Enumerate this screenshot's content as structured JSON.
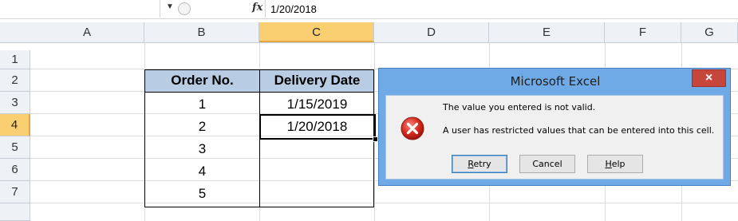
{
  "formula_bar": {
    "fx_label": "fx",
    "value": "1/20/2018"
  },
  "columns": [
    "A",
    "B",
    "C",
    "D",
    "E",
    "F",
    "G"
  ],
  "rows": [
    "1",
    "2",
    "3",
    "4",
    "5",
    "6",
    "7"
  ],
  "selected_column": "C",
  "selected_row": "4",
  "table": {
    "headers": [
      "Order No.",
      "Delivery Date"
    ],
    "rows": [
      [
        "1",
        "1/15/2019"
      ],
      [
        "2",
        "1/20/2018"
      ],
      [
        "3",
        ""
      ],
      [
        "4",
        ""
      ],
      [
        "5",
        ""
      ]
    ],
    "header_color": "#b8cce4"
  },
  "dialog": {
    "title": "Microsoft Excel",
    "close_label": "×",
    "message_line1": "The value you entered is not valid.",
    "message_line2": "A user has restricted values that can be entered into this cell.",
    "buttons": {
      "retry_underline": "R",
      "retry_rest": "etry",
      "cancel": "Cancel",
      "help_underline": "H",
      "help_rest": "elp"
    },
    "icon": "error-x-icon",
    "title_bar_color": "#6fa9e6",
    "close_color": "#c7463c"
  }
}
